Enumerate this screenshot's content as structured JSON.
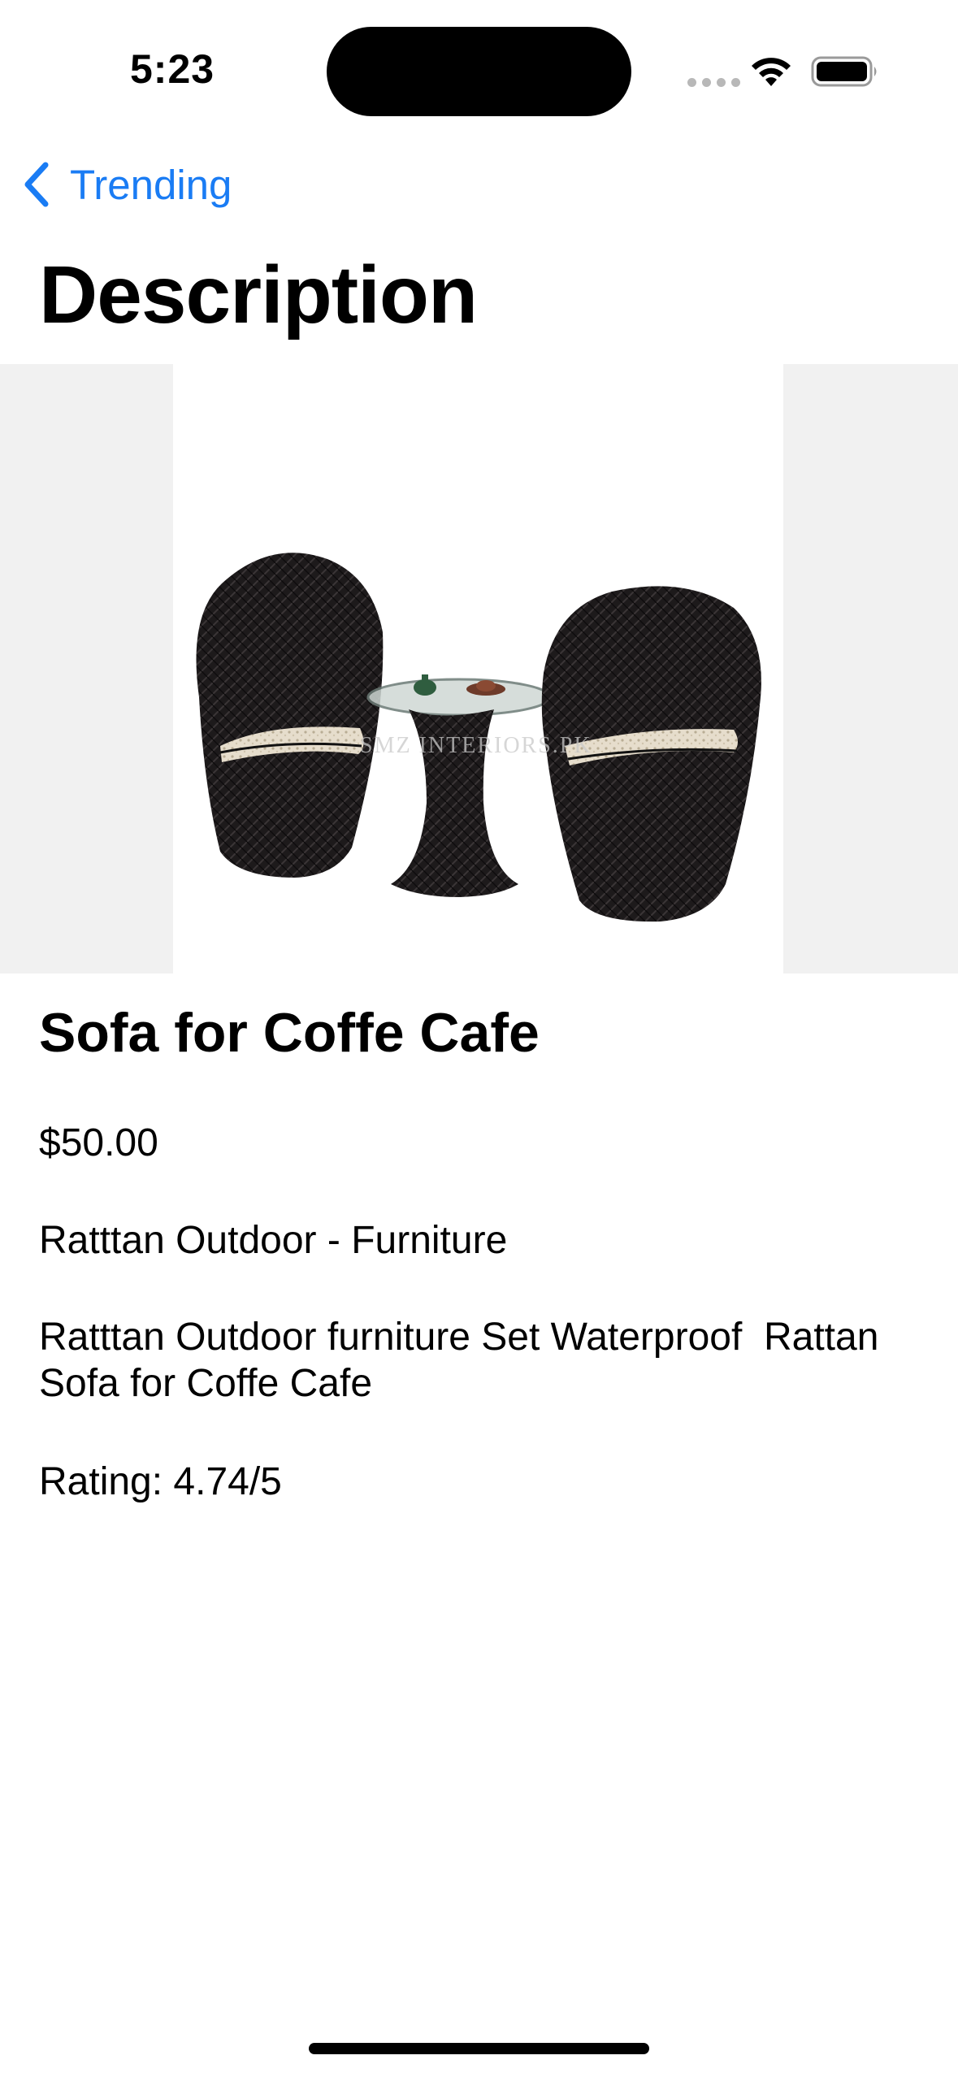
{
  "status_bar": {
    "time": "5:23"
  },
  "nav": {
    "back_label": "Trending",
    "title": "Description"
  },
  "product": {
    "image_watermark": "SMZ INTERIORS.PK",
    "name": "Sofa for Coffe Cafe",
    "price": "$50.00",
    "category": "Ratttan Outdoor - Furniture",
    "description": "Ratttan Outdoor furniture Set Waterproof  Rattan Sofa for Coffe Cafe",
    "rating": "Rating: 4.74/5"
  },
  "colors": {
    "accent": "#1a7cf4",
    "image_backdrop": "#f1f1f1",
    "text": "#000000"
  },
  "icons": [
    "wifi-icon",
    "battery-icon",
    "chevron-left-icon"
  ]
}
